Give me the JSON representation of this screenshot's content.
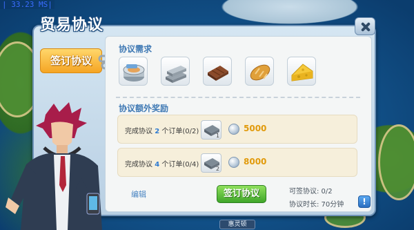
{
  "fps_text": "| 33.23 MS|",
  "dialog": {
    "title": "贸易协议",
    "tab_label": "签订协议",
    "requirements_title": "协议需求",
    "requirement_items": [
      {
        "icon": "canned-food-icon"
      },
      {
        "icon": "steel-bars-icon"
      },
      {
        "icon": "chocolate-icon"
      },
      {
        "icon": "bread-icon"
      },
      {
        "icon": "cheese-icon"
      }
    ],
    "extra_rewards_title": "协议额外奖励",
    "rewards": [
      {
        "prefix": "完成协议 ",
        "count": "2",
        "suffix": " 个订单(0/2)",
        "order_badge": "1",
        "amount": "5000"
      },
      {
        "prefix": "完成协议 ",
        "count": "4",
        "suffix": " 个订单(0/4)",
        "order_badge": "2",
        "amount": "8000"
      }
    ],
    "edit_link": "编辑",
    "sign_button": "签订协议",
    "available_label": "可签协议: 0/2",
    "duration_label": "协议时长: 70分钟",
    "help_label": "!"
  },
  "city_label": "惠灵顿",
  "colors": {
    "accent_orange": "#f5a524",
    "accent_green": "#3fa62a",
    "reward_amount": "#e19a0b",
    "section_title": "#3f79b4"
  }
}
